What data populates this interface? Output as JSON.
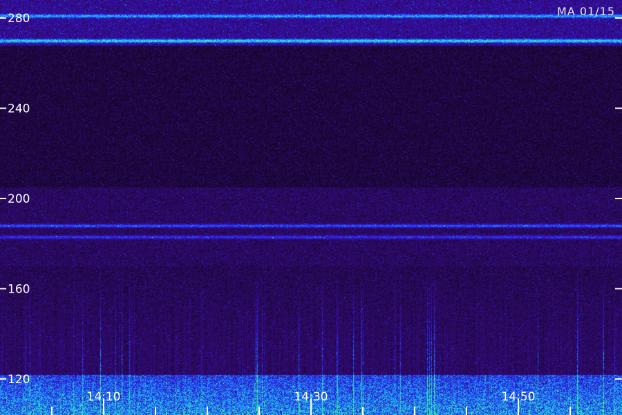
{
  "chart_data": {
    "type": "heatmap",
    "title": "MA 01/15",
    "xlabel": "",
    "ylabel": "",
    "x_tick_labels": [
      "14:10",
      "14:30",
      "14:50"
    ],
    "y_ticks": [
      120,
      160,
      200,
      240,
      280
    ],
    "ylim": [
      104,
      288
    ],
    "xlim_minutes": [
      0,
      60
    ],
    "x_label_minutes": [
      10,
      30,
      50
    ],
    "x_minor_tick_step_minutes": 5,
    "colormap": [
      "#000000",
      "#2a0a5a",
      "#3a0aa0",
      "#2030ff",
      "#1e90ff",
      "#20e0e0",
      "#40ff70"
    ],
    "bands": [
      {
        "freq": 270,
        "intensity": 0.85
      },
      {
        "freq": 281,
        "intensity": 0.65
      },
      {
        "freq": 188,
        "intensity": 0.55
      },
      {
        "freq": 183,
        "intensity": 0.45
      }
    ],
    "grid": false
  }
}
